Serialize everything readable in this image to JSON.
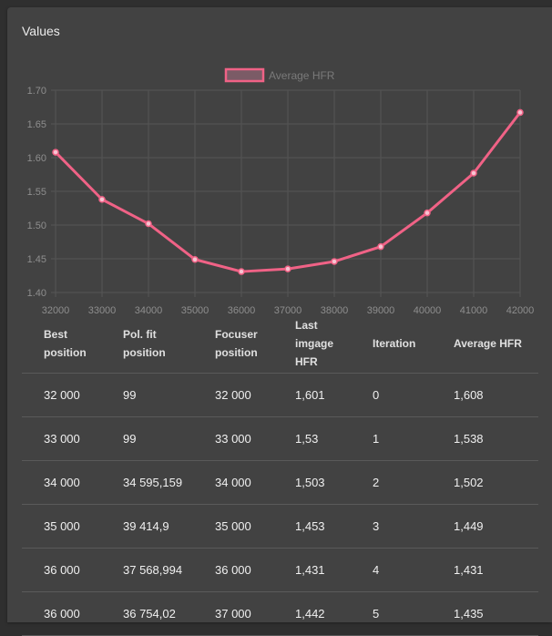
{
  "panel": {
    "title": "Values"
  },
  "colors": {
    "series": "#f06286",
    "point_fill": "#f7c4d2",
    "grid": "#555555",
    "tick": "#8e8e8e"
  },
  "chart_data": {
    "type": "line",
    "title": "",
    "xlabel": "",
    "ylabel": "",
    "x": [
      32000,
      33000,
      34000,
      35000,
      36000,
      37000,
      38000,
      39000,
      40000,
      41000,
      42000
    ],
    "series": [
      {
        "name": "Average HFR",
        "values": [
          1.608,
          1.538,
          1.502,
          1.449,
          1.431,
          1.435,
          1.446,
          1.468,
          1.518,
          1.577,
          1.667
        ]
      }
    ],
    "xticks": [
      "32000",
      "33000",
      "34000",
      "35000",
      "36000",
      "37000",
      "38000",
      "39000",
      "40000",
      "41000",
      "42000"
    ],
    "yticks": [
      "1.40",
      "1.45",
      "1.50",
      "1.55",
      "1.60",
      "1.65",
      "1.70"
    ],
    "xlim": [
      32000,
      42000
    ],
    "ylim": [
      1.4,
      1.7
    ],
    "grid": true,
    "legend": "top-center"
  },
  "table": {
    "headers": [
      "Best position",
      "Pol. fit position",
      "Focuser position",
      "Last imgage HFR",
      "Iteration",
      "Average HFR"
    ],
    "rows": [
      [
        "32 000",
        "99",
        "32 000",
        "1,601",
        "0",
        "1,608"
      ],
      [
        "33 000",
        "99",
        "33 000",
        "1,53",
        "1",
        "1,538"
      ],
      [
        "34 000",
        "34 595,159",
        "34 000",
        "1,503",
        "2",
        "1,502"
      ],
      [
        "35 000",
        "39 414,9",
        "35 000",
        "1,453",
        "3",
        "1,449"
      ],
      [
        "36 000",
        "37 568,994",
        "36 000",
        "1,431",
        "4",
        "1,431"
      ],
      [
        "36 000",
        "36 754,02",
        "37 000",
        "1,442",
        "5",
        "1,435"
      ]
    ]
  }
}
